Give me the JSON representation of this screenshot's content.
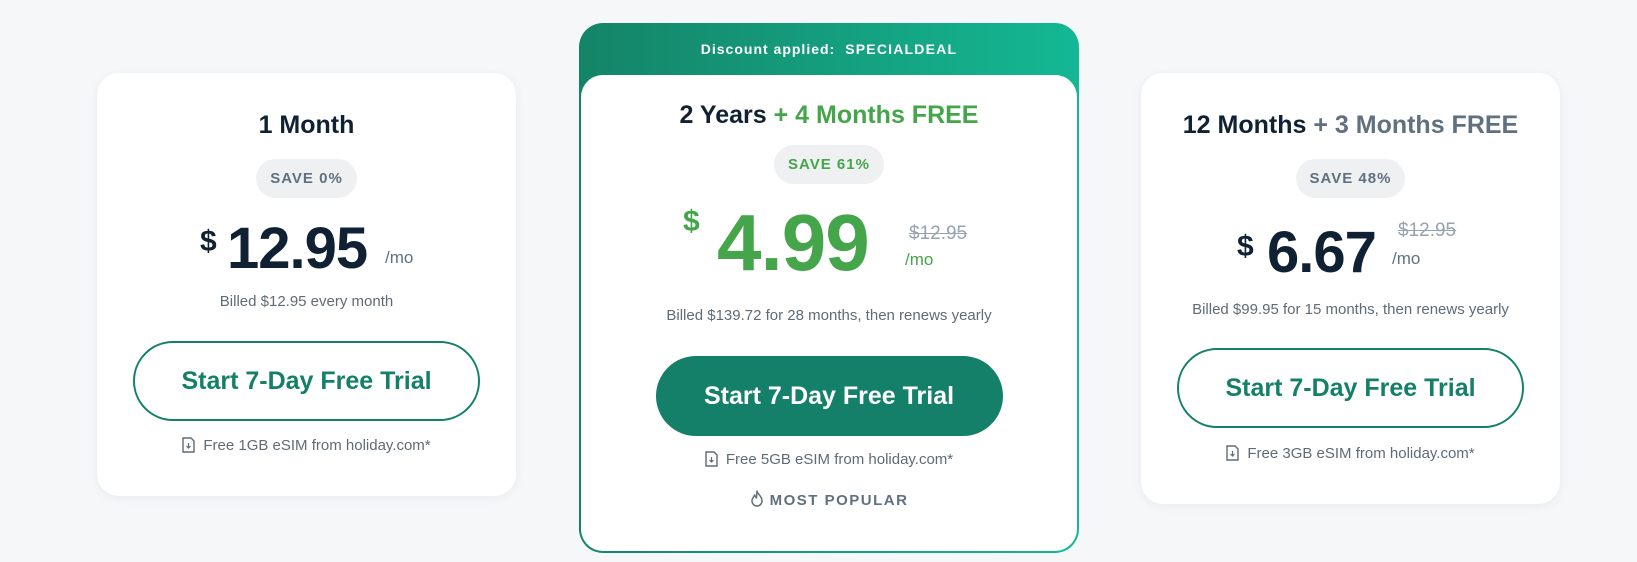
{
  "plans": [
    {
      "title": "1 Month",
      "save": "SAVE 0%",
      "currency": "$",
      "price": "12.95",
      "per": "/mo",
      "billed": "Billed $12.95 every month",
      "cta": "Start 7-Day Free Trial",
      "esim": "Free 1GB eSIM from holiday.com*"
    },
    {
      "banner_label": "Discount applied:",
      "banner_code": "SPECIALDEAL",
      "title": "2 Years",
      "title_extra": "+ 4 Months FREE",
      "save": "SAVE 61%",
      "currency": "$",
      "price": "4.99",
      "original_price": "$12.95",
      "per": "/mo",
      "billed": "Billed $139.72 for 28 months, then renews yearly",
      "cta": "Start 7-Day Free Trial",
      "esim": "Free 5GB eSIM from holiday.com*",
      "popular": "MOST POPULAR"
    },
    {
      "title": "12 Months",
      "title_extra": "+ 3 Months FREE",
      "save": "SAVE 48%",
      "currency": "$",
      "price": "6.67",
      "original_price": "$12.95",
      "per": "/mo",
      "billed": "Billed $99.95 for 15 months, then renews yearly",
      "cta": "Start 7-Day Free Trial",
      "esim": "Free 3GB eSIM from holiday.com*"
    }
  ],
  "colors": {
    "brand": "#15806a",
    "accent_green": "#44a54a",
    "text_dark": "#0f2133",
    "muted": "#5f7180",
    "background": "#f6f7f9"
  },
  "icons": {
    "esim": "sim-card-icon",
    "popular": "fire-icon"
  }
}
